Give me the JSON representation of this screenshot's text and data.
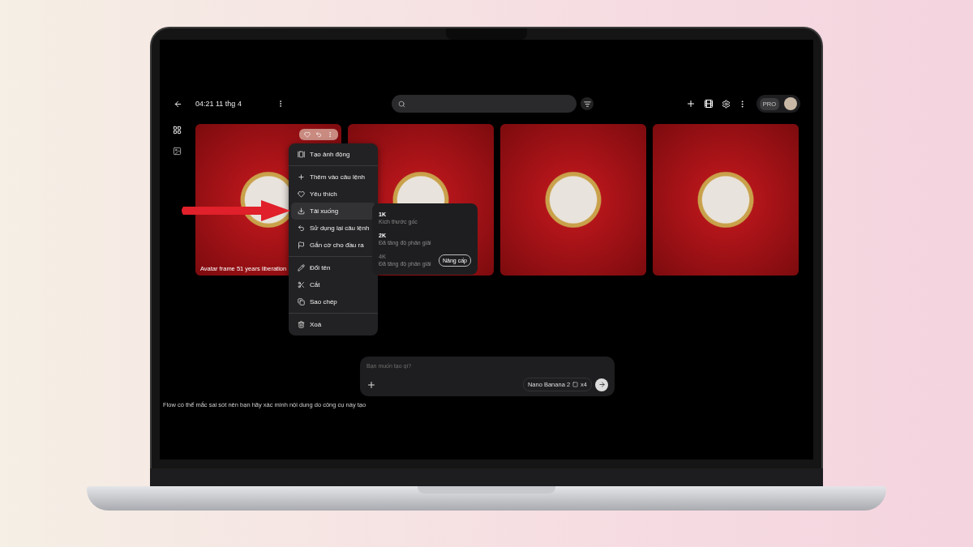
{
  "header": {
    "time": "04:21 11 thg 4",
    "badge": "PRO"
  },
  "sidebar": {
    "items": [
      {
        "selected": true
      },
      {
        "selected": false
      }
    ]
  },
  "thumbnails": [
    {
      "hovered": true,
      "caption": "Avatar frame 51 years liberation"
    },
    {
      "hovered": false
    },
    {
      "hovered": false
    },
    {
      "hovered": false
    }
  ],
  "menu": {
    "groups": [
      [
        {
          "label": "Tạo ảnh động",
          "selected": false
        }
      ],
      [
        {
          "label": "Thêm vào câu lệnh",
          "selected": false
        },
        {
          "label": "Yêu thích",
          "selected": false
        },
        {
          "label": "Tải xuống",
          "selected": true
        },
        {
          "label": "Sử dụng lại câu lệnh",
          "selected": false
        },
        {
          "label": "Gắn cờ cho đầu ra",
          "selected": false
        }
      ],
      [
        {
          "label": "Đổi tên",
          "selected": false
        },
        {
          "label": "Cắt",
          "selected": false
        },
        {
          "label": "Sao chép",
          "selected": false
        }
      ],
      [
        {
          "label": "Xoá",
          "selected": false
        }
      ]
    ]
  },
  "submenu": {
    "options": [
      {
        "label": "1K",
        "note": "Kích thước gốc",
        "disabled": false
      },
      {
        "label": "2K",
        "note": "Đã tăng độ phân giải",
        "disabled": false
      },
      {
        "label": "4K",
        "note": "Đã tăng độ phân giải",
        "disabled": true,
        "action": "Nâng cấp"
      }
    ]
  },
  "prompt": {
    "placeholder": "Bạn muốn tạo gì?",
    "model": "Nano Banana 2",
    "count": "x4"
  },
  "disclaimer": "Flow có thể mắc sai sót nên bạn hãy xác minh nội dung do công cụ này tạo"
}
